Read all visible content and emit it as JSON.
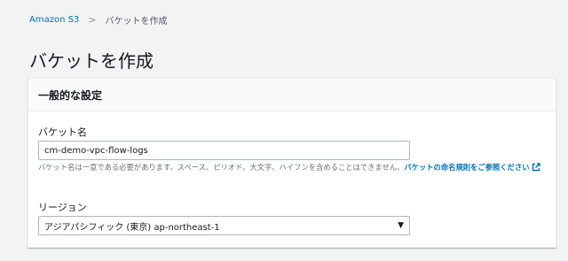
{
  "breadcrumb": {
    "root": "Amazon S3",
    "separator": ">",
    "current": "バケットを作成"
  },
  "page": {
    "title": "バケットを作成"
  },
  "panel": {
    "header": "一般的な設定",
    "bucket_name": {
      "label": "バケット名",
      "value": "cm-demo-vpc-flow-logs",
      "hint": "バケット名は一意である必要があります。スペース、ピリオド、大文字、ハイフンを含めることはできません。",
      "hint_link": "バケットの命名規則をご参照ください",
      "link_icon": "external-link-icon"
    },
    "region": {
      "label": "リージョン",
      "selected": "アジアパシフィック (東京) ap-northeast-1",
      "caret_icon": "caret-down-icon",
      "caret_glyph": "▼"
    }
  },
  "colors": {
    "link": "#0073bb",
    "background": "#f2f3f3",
    "panel_header": "#fafafa"
  }
}
